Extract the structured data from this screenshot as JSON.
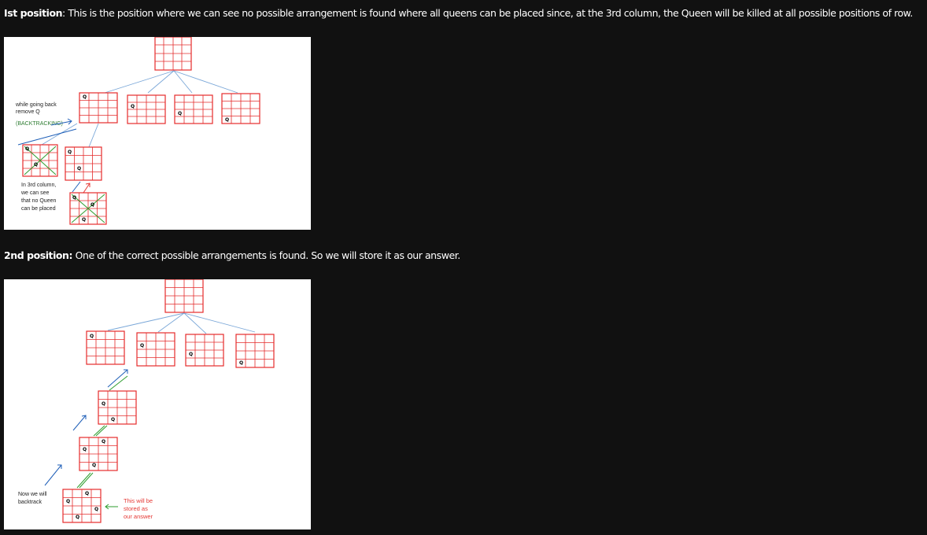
{
  "section1": {
    "label": "Ist position",
    "text": ": This is the position where we can see no possible arrangement is found where all queens can be placed since, at the 3rd column, the Queen will be killed at all possible positions of row."
  },
  "figure1": {
    "queen_mark": "Q",
    "note_going_back_line1": "while going back",
    "note_going_back_line2": "remove Q",
    "note_backtracking": "(BACKTRACKING)",
    "note_3rd_col_line1": "In 3rd column,",
    "note_3rd_col_line2": "we can see",
    "note_3rd_col_line3": "that no Queen",
    "note_3rd_col_line4": "can be placed"
  },
  "section2": {
    "label": "2nd position:",
    "text": " One of the correct possible arrangements is found. So we will store it as our answer."
  },
  "figure2": {
    "queen_mark": "Q",
    "note_backtrack_line1": "Now we will",
    "note_backtrack_line2": "backtrack",
    "note_answer_line1": "This will be",
    "note_answer_line2": "stored as",
    "note_answer_line3": "our answer"
  },
  "colors": {
    "page_background": "#111111",
    "text": "#ffffff",
    "grid": "#e52b2b",
    "tree_links": "#7aa7d8",
    "forward_arrow": "#1f5fb8",
    "backtrack_arrow": "#2e9d2e",
    "answer_note": "#e53935"
  }
}
